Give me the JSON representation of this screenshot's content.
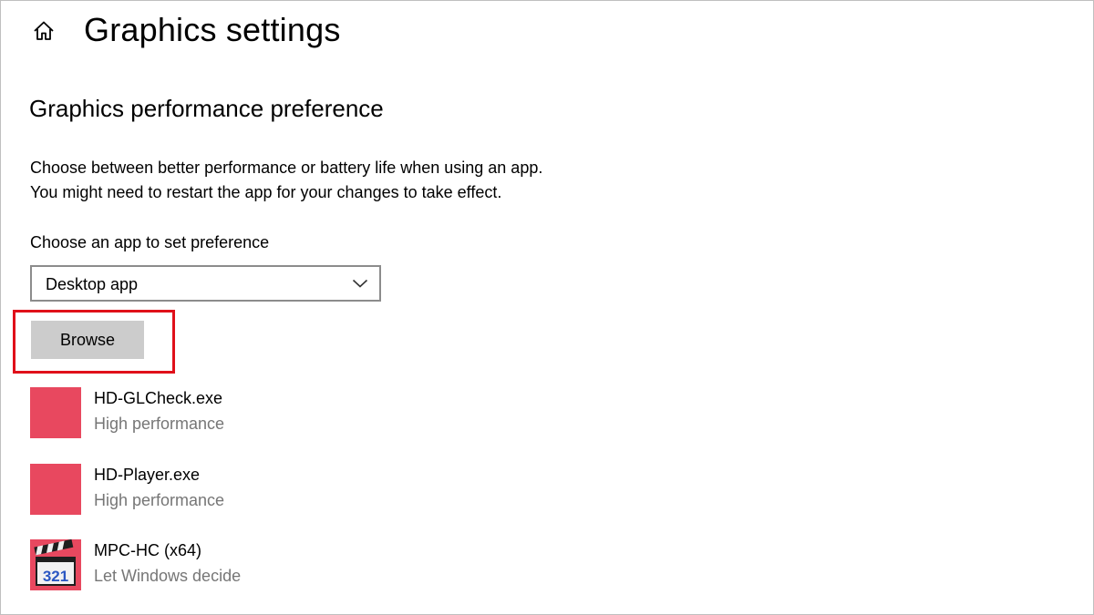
{
  "header": {
    "title": "Graphics settings",
    "home_icon": "home-icon"
  },
  "section": {
    "title": "Graphics performance preference",
    "description_line1": "Choose between better performance or battery life when using an app.",
    "description_line2": "You might need to restart the app for your changes to take effect."
  },
  "app_picker": {
    "label": "Choose an app to set preference",
    "selected": "Desktop app",
    "browse_label": "Browse"
  },
  "colors": {
    "highlight": "#e0101a",
    "app_tile": "#e8485f",
    "secondary_text": "#767676",
    "button_bg": "#cccccc"
  },
  "apps": [
    {
      "name": "HD-GLCheck.exe",
      "preference": "High performance",
      "icon": "red-tile-icon"
    },
    {
      "name": "HD-Player.exe",
      "preference": "High performance",
      "icon": "red-tile-icon"
    },
    {
      "name": "MPC-HC (x64)",
      "preference": "Let Windows decide",
      "icon": "clapperboard-321-icon"
    }
  ]
}
